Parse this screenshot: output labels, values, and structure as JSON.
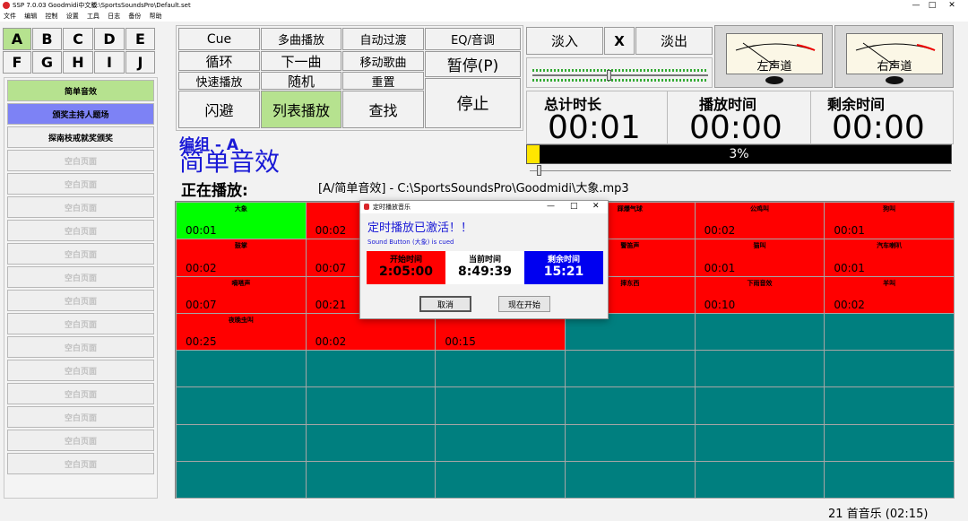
{
  "window": {
    "title": "SSP 7.0.03 Goodmidi中文版",
    "path": "C:\\SportsSoundsPro\\Default.set"
  },
  "menu": [
    "文件",
    "编辑",
    "控制",
    "设置",
    "工具",
    "日志",
    "备份",
    "帮助"
  ],
  "letters": [
    "A",
    "B",
    "C",
    "D",
    "E",
    "F",
    "G",
    "H",
    "I",
    "J"
  ],
  "banks": [
    "简单音效",
    "颁奖主持人题场",
    "探南枝戒就奖颁奖",
    "空白页面",
    "空白页面",
    "空白页面",
    "空白页面",
    "空白页面",
    "空白页面",
    "空白页面",
    "空白页面",
    "空白页面",
    "空白页面",
    "空白页面",
    "空白页面",
    "空白页面",
    "空白页面"
  ],
  "controls": {
    "cue": "Cue",
    "multi": "多曲播放",
    "auto_fade": "自动过渡",
    "eq": "EQ/音调",
    "loop": "循环",
    "next": "下一曲",
    "move": "移动歌曲",
    "pause": "暂停(P)",
    "quick": "快速播放",
    "random": "随机",
    "reset": "重置",
    "flash": "闪避",
    "list": "列表播放",
    "find": "查找",
    "stop": "停止",
    "fade_in": "淡入",
    "x": "X",
    "fade_out": "淡出"
  },
  "meters": {
    "left": "左声道",
    "right": "右声道"
  },
  "time": {
    "total_label": "总计时长",
    "total": "00:01",
    "played_label": "播放时间",
    "played": "00:00",
    "remain_label": "剩余时间",
    "remain": "00:00",
    "progress_text": "3%",
    "progress": 0.03
  },
  "group": {
    "label": "编组 - A",
    "name": "简单音效",
    "now_label": "正在播放:",
    "now_path": "[A/简单音效] - C:\\SportsSoundsPro\\Goodmidi\\大象.mp3"
  },
  "grid": [
    {
      "name": "大象",
      "time": "00:01",
      "color": "#00ff00"
    },
    {
      "name": "",
      "time": "00:02",
      "color": "#ff0000"
    },
    {
      "name": "",
      "time": "",
      "color": "#ff0000"
    },
    {
      "name": "踩爆气球",
      "time": "",
      "color": "#ff0000"
    },
    {
      "name": "公鸡叫",
      "time": "00:02",
      "color": "#ff0000"
    },
    {
      "name": "狗叫",
      "time": "00:01",
      "color": "#ff0000"
    },
    {
      "name": "鼓掌",
      "time": "00:02",
      "color": "#ff0000"
    },
    {
      "name": "",
      "time": "00:07",
      "color": "#ff0000"
    },
    {
      "name": "",
      "time": "",
      "color": "#ff0000"
    },
    {
      "name": "警笛声",
      "time": "",
      "color": "#ff0000"
    },
    {
      "name": "猫叫",
      "time": "00:01",
      "color": "#ff0000"
    },
    {
      "name": "汽车喇叭",
      "time": "00:01",
      "color": "#ff0000"
    },
    {
      "name": "嘀嗒声",
      "time": "00:07",
      "color": "#ff0000"
    },
    {
      "name": "",
      "time": "00:21",
      "color": "#ff0000"
    },
    {
      "name": "",
      "time": "",
      "color": "#ff0000"
    },
    {
      "name": "摔东西",
      "time": "",
      "color": "#ff0000"
    },
    {
      "name": "下雨音效",
      "time": "00:10",
      "color": "#ff0000"
    },
    {
      "name": "羊叫",
      "time": "00:02",
      "color": "#ff0000"
    },
    {
      "name": "夜晚虫叫",
      "time": "00:25",
      "color": "#ff0000"
    },
    {
      "name": "",
      "time": "00:02",
      "color": "#ff0000"
    },
    {
      "name": "",
      "time": "00:15",
      "color": "#ff0000"
    }
  ],
  "dialog": {
    "title": "定时播放音乐",
    "headline": "定时播放已激活！！",
    "sub": "Sound Button (大象) is cued",
    "start_label": "开始时间",
    "start": "2:05:00",
    "now_label": "当前时间",
    "now": "8:49:39",
    "remain_label": "剩余时间",
    "remain": "15:21",
    "cancel": "取消",
    "start_now": "现在开始"
  },
  "status": "21 首音乐 (02:15)",
  "colors": {
    "cell_red": "#ff0000",
    "cell_green": "#00ff00",
    "empty_teal": "#007f7f",
    "bank_active": "#b6e28f",
    "bank_selected": "#7d82f5"
  }
}
